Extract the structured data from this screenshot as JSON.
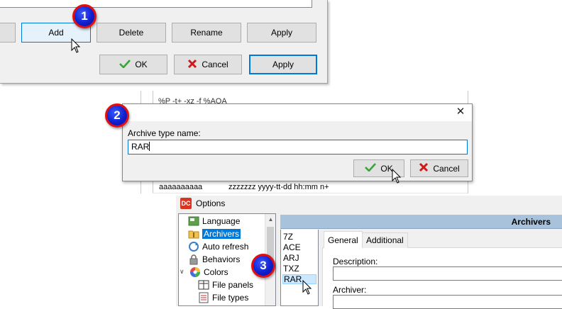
{
  "panel1": {
    "buttons": {
      "add": "Add",
      "delete": "Delete",
      "rename": "Rename",
      "apply_top": "Apply",
      "ok": "OK",
      "cancel": "Cancel",
      "apply_bottom": "Apply"
    }
  },
  "background_list": {
    "top_row_text": "%P -t+ -xz -f %AOA",
    "bottom_row_col1": "aaaaaaaaaa",
    "bottom_row_col2": "zzzzzzz yyyy-tt-dd hh:mm n+"
  },
  "archive_dialog": {
    "close_glyph": "✕",
    "label": "Archive type name:",
    "input_value": "RAR",
    "ok_label": "OK",
    "cancel_label": "Cancel"
  },
  "options": {
    "window_title": "Options",
    "logo_text": "DC",
    "tree": [
      {
        "label": "Language",
        "icon": "language-icon"
      },
      {
        "label": "Archivers",
        "icon": "archive-folder-icon",
        "selected": true
      },
      {
        "label": "Auto refresh",
        "icon": "refresh-icon"
      },
      {
        "label": "Behaviors",
        "icon": "lock-icon"
      },
      {
        "label": "Colors",
        "icon": "color-wheel-icon",
        "expanded": true
      },
      {
        "label": "File panels",
        "icon": "file-panels-icon"
      },
      {
        "label": "File types",
        "icon": "file-types-icon"
      }
    ],
    "page_header": "Archivers",
    "archivers": [
      "7Z",
      "ACE",
      "ARJ",
      "TXZ",
      "RAR"
    ],
    "selected_archiver": "RAR",
    "tabs": [
      "General",
      "Additional"
    ],
    "active_tab": "General",
    "fields": {
      "description_label": "Description:",
      "archiver_label": "Archiver:"
    }
  },
  "steps": [
    "1",
    "2",
    "3"
  ],
  "colors": {
    "accent": "#0078d7",
    "badge_fill": "#1020d0",
    "badge_ring": "#e01010",
    "ok_check": "#3aa33a",
    "cancel_x": "#d01818",
    "page_header_bg": "#a9c2dc"
  }
}
